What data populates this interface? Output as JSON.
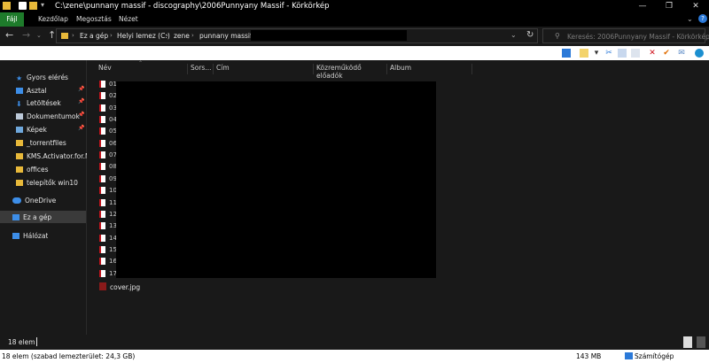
{
  "title": "C:\\zene\\punnany massif - discography\\2006Punnyany Massif - Körkörkép",
  "window_controls": {
    "minimize": "—",
    "maximize": "❐",
    "close": "✕"
  },
  "ribbon": {
    "tabs": [
      {
        "label": "Fájl"
      },
      {
        "label": "Kezdőlap"
      },
      {
        "label": "Megosztás"
      },
      {
        "label": "Nézet"
      }
    ],
    "help": "?"
  },
  "address": {
    "crumbs": [
      "Ez a gép",
      "Helyi lemez (C:)",
      "zene",
      "punnany massif -"
    ]
  },
  "search": {
    "placeholder": "Keresés: 2006Punnyany Massif - Körkörkép"
  },
  "sidebar": {
    "items": [
      {
        "label": "Gyors elérés",
        "icon": "star-icon",
        "pinned": false
      },
      {
        "label": "Asztal",
        "icon": "desktop-icon",
        "pinned": true
      },
      {
        "label": "Letöltések",
        "icon": "download-icon",
        "pinned": true
      },
      {
        "label": "Dokumentumok",
        "icon": "document-icon",
        "pinned": true
      },
      {
        "label": "Képek",
        "icon": "pictures-icon",
        "pinned": true
      },
      {
        "label": "_torrentfiles",
        "icon": "folder-icon",
        "pinned": false
      },
      {
        "label": "KMS.Activator.for.M",
        "icon": "folder-icon",
        "pinned": false
      },
      {
        "label": "offices",
        "icon": "folder-icon",
        "pinned": false
      },
      {
        "label": "telepítők win10",
        "icon": "folder-icon",
        "pinned": false
      },
      {
        "label": "OneDrive",
        "icon": "cloud-icon",
        "pinned": false
      },
      {
        "label": "Ez a gép",
        "icon": "computer-icon",
        "pinned": false,
        "selected": true
      },
      {
        "label": "Hálózat",
        "icon": "network-icon",
        "pinned": false
      }
    ]
  },
  "columns": [
    {
      "label": "Név"
    },
    {
      "label": "Sors..."
    },
    {
      "label": "Cím"
    },
    {
      "label": "Közreműködő előadók"
    },
    {
      "label": "Album"
    }
  ],
  "files": [
    {
      "num": "01"
    },
    {
      "num": "02"
    },
    {
      "num": "03"
    },
    {
      "num": "04"
    },
    {
      "num": "05"
    },
    {
      "num": "06"
    },
    {
      "num": "07"
    },
    {
      "num": "08"
    },
    {
      "num": "09"
    },
    {
      "num": "10"
    },
    {
      "num": "11"
    },
    {
      "num": "12"
    },
    {
      "num": "13"
    },
    {
      "num": "14"
    },
    {
      "num": "15"
    },
    {
      "num": "16"
    },
    {
      "num": "17"
    }
  ],
  "cover_file": "cover.jpg",
  "item_count": "18 elem",
  "status": {
    "left": "18 elem (szabad lemezterület: 24,3 GB)",
    "size": "143 MB",
    "location": "Számítógép"
  },
  "colors": {
    "file_tab": "#1e7b2b",
    "accent": "#2b79d8",
    "folder": "#e8b93a"
  }
}
